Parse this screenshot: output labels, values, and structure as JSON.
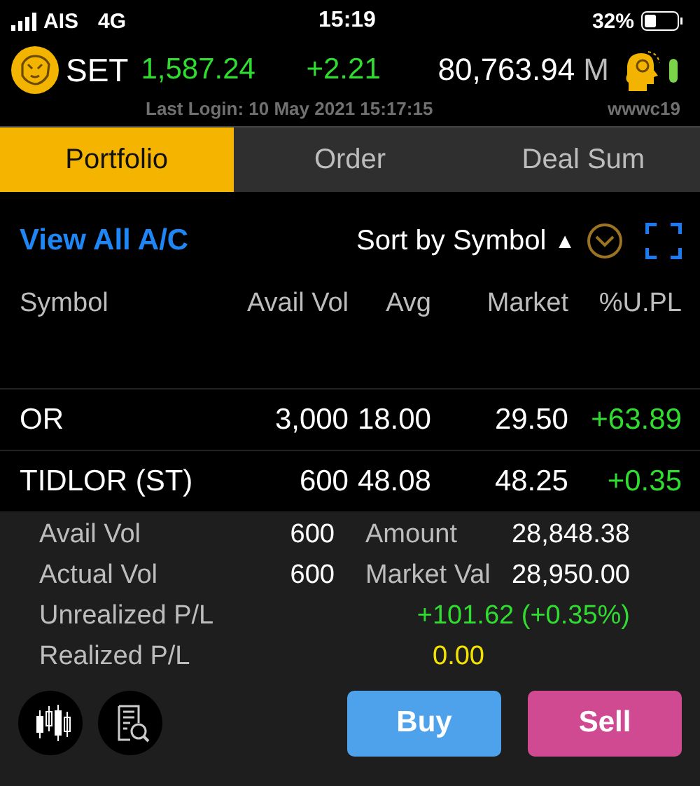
{
  "status_bar": {
    "carrier": "AIS",
    "network": "4G",
    "time": "15:19",
    "battery": "32%"
  },
  "header": {
    "index": "SET",
    "value": "1,587.24",
    "change": "+2.21",
    "volume": "80,763.94",
    "volume_unit": "M",
    "last_login": "Last Login: 10 May 2021 15:17:15",
    "user": "wwwc19"
  },
  "tabs": [
    {
      "label": "Portfolio",
      "selected": true
    },
    {
      "label": "Order",
      "selected": false
    },
    {
      "label": "Deal Sum",
      "selected": false
    }
  ],
  "toolbar": {
    "view_all": "View All A/C",
    "sort": "Sort by Symbol",
    "sort_arrow": "▲"
  },
  "table": {
    "columns": [
      "Symbol",
      "Avail Vol",
      "Avg",
      "Market",
      "%U.PL"
    ],
    "rows": [
      {
        "symbol": "OR",
        "avail_vol": "3,000",
        "avg": "18.00",
        "market": "29.50",
        "upl": "+63.89"
      },
      {
        "symbol": "TIDLOR (ST)",
        "avail_vol": "600",
        "avg": "48.08",
        "market": "48.25",
        "upl": "+0.35"
      }
    ]
  },
  "detail": {
    "avail_vol_label": "Avail Vol",
    "avail_vol": "600",
    "amount_label": "Amount",
    "amount": "28,848.38",
    "actual_vol_label": "Actual Vol",
    "actual_vol": "600",
    "market_val_label": "Market Val",
    "market_val": "28,950.00",
    "unrealized_label": "Unrealized P/L",
    "unrealized": "+101.62 (+0.35%)",
    "realized_label": "Realized P/L",
    "realized": "0.00"
  },
  "buttons": [
    {
      "label": "Buy",
      "kind": "buy"
    },
    {
      "label": "Sell",
      "kind": "sell"
    }
  ]
}
